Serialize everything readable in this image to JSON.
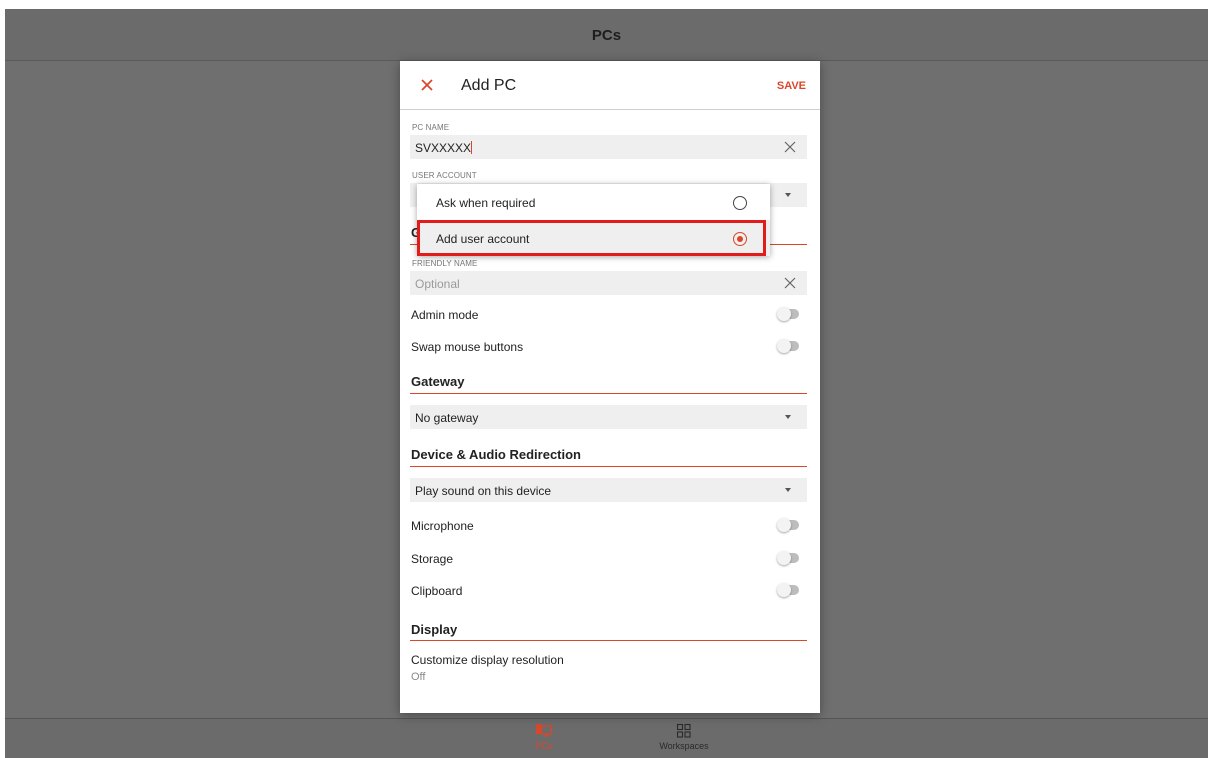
{
  "app": {
    "title": "PCs",
    "bottom_tabs": [
      {
        "label": "PCs",
        "icon": "monitor-icon"
      },
      {
        "label": "Workspaces",
        "icon": "grid-icon"
      }
    ]
  },
  "dialog": {
    "title": "Add PC",
    "save_label": "SAVE",
    "pc_name": {
      "label": "PC NAME",
      "value": "SVXXXXX"
    },
    "user_account": {
      "label": "USER ACCOUNT"
    },
    "friendly_name": {
      "label": "FRIENDLY NAME",
      "placeholder": "Optional"
    },
    "general_toggles": [
      {
        "label": "Admin mode",
        "on": false
      },
      {
        "label": "Swap mouse buttons",
        "on": false
      }
    ],
    "gateway": {
      "section": "Gateway",
      "value": "No gateway"
    },
    "device_audio": {
      "section": "Device & Audio Redirection",
      "value": "Play sound on this device",
      "toggles": [
        {
          "label": "Microphone",
          "on": false
        },
        {
          "label": "Storage",
          "on": false
        },
        {
          "label": "Clipboard",
          "on": false
        }
      ]
    },
    "display": {
      "section": "Display",
      "item_label": "Customize display resolution",
      "item_value": "Off"
    },
    "peek_letter": "G"
  },
  "user_account_popup": {
    "options": [
      {
        "label": "Ask when required",
        "selected": false
      },
      {
        "label": "Add user account",
        "selected": true
      }
    ]
  },
  "colors": {
    "accent": "#d9472b",
    "highlight_box": "#e21b1b",
    "backdrop": "#6f6f6f"
  }
}
